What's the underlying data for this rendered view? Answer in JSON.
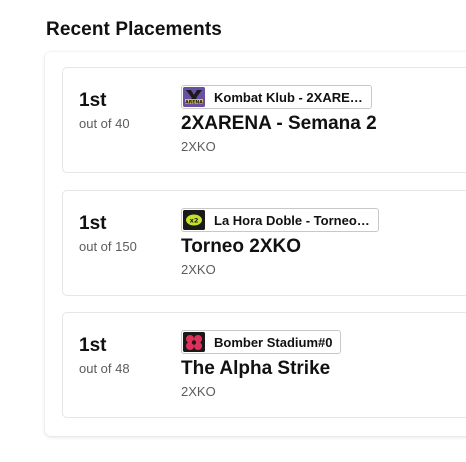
{
  "section": {
    "title": "Recent Placements"
  },
  "placements": [
    {
      "place": "1st",
      "out_of": "out of 40",
      "host": "Kombat Klub - 2XARE…",
      "logo": "kombat-klub-logo",
      "event": "2XARENA - Semana 2",
      "game": "2XKO"
    },
    {
      "place": "1st",
      "out_of": "out of 150",
      "host": "La Hora Doble - Torneo…",
      "logo": "la-hora-doble-logo",
      "event": "Torneo 2XKO",
      "game": "2XKO"
    },
    {
      "place": "1st",
      "out_of": "out of 48",
      "host": "Bomber Stadium#0",
      "logo": "bomber-stadium-logo",
      "event": "The Alpha Strike",
      "game": "2XKO"
    }
  ],
  "colors": {
    "kombat_logo_bg": "#6a4fa3",
    "hora_doble_logo_bg": "#1a1a1a",
    "hora_doble_logo_fg": "#c6e02a",
    "bomber_logo_bg": "#1a1a1a",
    "bomber_logo_fg": "#e0305a"
  }
}
